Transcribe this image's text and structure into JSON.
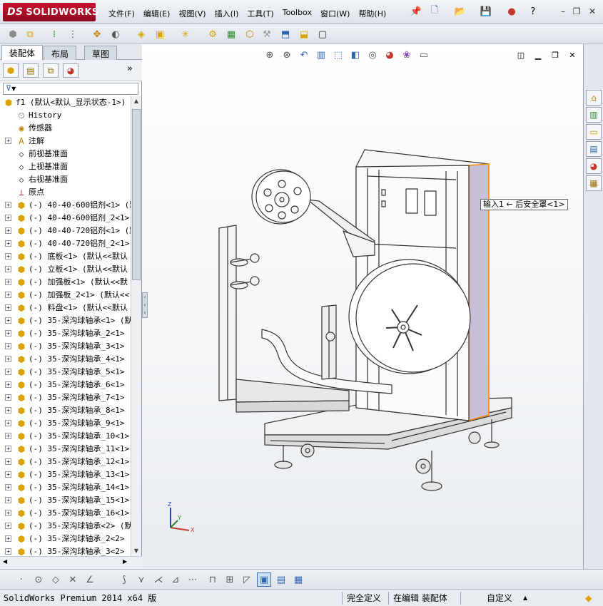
{
  "app": {
    "brand_ds": "DS",
    "brand_name": "SOLIDWORKS"
  },
  "menu": [
    {
      "label": "文件(F)"
    },
    {
      "label": "编辑(E)"
    },
    {
      "label": "视图(V)"
    },
    {
      "label": "插入(I)"
    },
    {
      "label": "工具(T)"
    },
    {
      "label": "Toolbox"
    },
    {
      "label": "窗口(W)"
    },
    {
      "label": "帮助(H)"
    }
  ],
  "title_icons": [
    "pin-icon",
    "new-document-icon",
    "open-icon",
    "save-icon",
    "traffic-light-icon",
    "help-icon"
  ],
  "window_controls": {
    "minimize": "–",
    "restore": "❐",
    "close": "✕"
  },
  "toolbar_icons": [
    "assembly-insert-icon",
    "mate-icon",
    "linear-pattern-icon",
    "smart-fasteners-icon",
    "move-component-icon",
    "show-hidden-icon",
    "assembly-features-icon",
    "reference-geometry-icon",
    "new-motion-study-icon",
    "bill-of-materials-icon",
    "exploded-view-icon",
    "explode-line-sketch-icon",
    "interference-detection-icon",
    "clearance-verification-icon",
    "hole-alignment-icon",
    "instant3d-icon"
  ],
  "left_panel": {
    "tabs": [
      {
        "label": "装配体",
        "active": true
      },
      {
        "label": "布局",
        "active": false
      },
      {
        "label": "草图",
        "active": false
      }
    ],
    "pane_icons": [
      "feature-manager-icon",
      "property-manager-icon",
      "configuration-manager-icon",
      "appearance-icon"
    ],
    "more": "»",
    "filter_glyph": "▼",
    "root": {
      "label": "f1  (默认<默认_显示状态-1>)"
    },
    "nodes": [
      {
        "label": "History",
        "icon": "history-icon",
        "expandable": false
      },
      {
        "label": "传感器",
        "icon": "sensor-icon",
        "expandable": false
      },
      {
        "label": "注解",
        "icon": "annotation-icon",
        "expandable": true
      },
      {
        "label": "前视基准面",
        "icon": "plane-icon",
        "expandable": false
      },
      {
        "label": "上视基准面",
        "icon": "plane-icon",
        "expandable": false
      },
      {
        "label": "右视基准面",
        "icon": "plane-icon",
        "expandable": false
      },
      {
        "label": "原点",
        "icon": "origin-icon",
        "expandable": false
      },
      {
        "label": "(-) 40-40-600铝剂<1> (默",
        "icon": "part-icon",
        "expandable": true
      },
      {
        "label": "(-) 40-40-600铝剂_2<1>",
        "icon": "part-icon",
        "expandable": true
      },
      {
        "label": "(-) 40-40-720铝剂<1> (默",
        "icon": "part-icon",
        "expandable": true
      },
      {
        "label": "(-) 40-40-720铝剂_2<1>",
        "icon": "part-icon",
        "expandable": true
      },
      {
        "label": "(-) 底板<1> (默认<<默认",
        "icon": "part-icon",
        "expandable": true
      },
      {
        "label": "(-) 立板<1> (默认<<默认",
        "icon": "part-icon",
        "expandable": true
      },
      {
        "label": "(-) 加强板<1> (默认<<默",
        "icon": "part-icon",
        "expandable": true
      },
      {
        "label": "(-) 加强板_2<1> (默认<<",
        "icon": "part-icon",
        "expandable": true
      },
      {
        "label": "(-) 料盘<1> (默认<<默认",
        "icon": "part-icon",
        "expandable": true
      },
      {
        "label": "(-) 35-深沟球轴承<1> (默",
        "icon": "part-icon",
        "expandable": true
      },
      {
        "label": "(-) 35-深沟球轴承_2<1>",
        "icon": "part-icon",
        "expandable": true
      },
      {
        "label": "(-) 35-深沟球轴承_3<1>",
        "icon": "part-icon",
        "expandable": true
      },
      {
        "label": "(-) 35-深沟球轴承_4<1>",
        "icon": "part-icon",
        "expandable": true
      },
      {
        "label": "(-) 35-深沟球轴承_5<1>",
        "icon": "part-icon",
        "expandable": true
      },
      {
        "label": "(-) 35-深沟球轴承_6<1>",
        "icon": "part-icon",
        "expandable": true
      },
      {
        "label": "(-) 35-深沟球轴承_7<1>",
        "icon": "part-icon",
        "expandable": true
      },
      {
        "label": "(-) 35-深沟球轴承_8<1>",
        "icon": "part-icon",
        "expandable": true
      },
      {
        "label": "(-) 35-深沟球轴承_9<1>",
        "icon": "part-icon",
        "expandable": true
      },
      {
        "label": "(-) 35-深沟球轴承_10<1>",
        "icon": "part-icon",
        "expandable": true
      },
      {
        "label": "(-) 35-深沟球轴承_11<1>",
        "icon": "part-icon",
        "expandable": true
      },
      {
        "label": "(-) 35-深沟球轴承_12<1>",
        "icon": "part-icon",
        "expandable": true
      },
      {
        "label": "(-) 35-深沟球轴承_13<1>",
        "icon": "part-icon",
        "expandable": true
      },
      {
        "label": "(-) 35-深沟球轴承_14<1>",
        "icon": "part-icon",
        "expandable": true
      },
      {
        "label": "(-) 35-深沟球轴承_15<1>",
        "icon": "part-icon",
        "expandable": true
      },
      {
        "label": "(-) 35-深沟球轴承_16<1>",
        "icon": "part-icon",
        "expandable": true
      },
      {
        "label": "(-) 35-深沟球轴承<2> (默",
        "icon": "part-icon",
        "expandable": true
      },
      {
        "label": "(-) 35-深沟球轴承_2<2>",
        "icon": "part-icon",
        "expandable": true
      },
      {
        "label": "(-) 35-深沟球轴承_3<2>",
        "icon": "part-icon",
        "expandable": true
      }
    ]
  },
  "graphics": {
    "callout": "输入1 ← 后安全罩<1>",
    "triad": {
      "x": "X",
      "y": "Y",
      "z": "Z"
    },
    "headsup_icons": [
      "zoom-to-fit-icon",
      "zoom-to-area-icon",
      "previous-view-icon",
      "section-view-icon",
      "view-orientation-icon",
      "display-style-icon",
      "hide-show-items-icon",
      "edit-appearance-icon",
      "apply-scene-icon",
      "view-settings-icon"
    ],
    "model_colors": {
      "shield": "#c8bfd6",
      "frame": "#eeeeee",
      "line": "#333333",
      "highlight": "#ff8a00"
    }
  },
  "task_pane_icons": [
    "resources-icon",
    "design-library-icon",
    "file-explorer-icon",
    "view-palette-icon",
    "appearances-scenes-icon",
    "custom-properties-icon"
  ],
  "view_toolbar_icons": [
    "point-icon",
    "circle-icon",
    "polygon-icon",
    "trim-icon",
    "extend-icon",
    "fillet-icon",
    "chamfer-icon",
    "offset-icon",
    "mirror-icon",
    "grid-icon",
    "midpoint-icon",
    "active-view-icon",
    "tiled-view-icon",
    "split-view-icon"
  ],
  "status_bar": {
    "product": "SolidWorks Premium 2014 x64 版",
    "definition": "完全定义",
    "editing": "在编辑 装配体",
    "units": "自定义",
    "units_arrow": "▲",
    "rebuild_icon": "tag-icon"
  }
}
